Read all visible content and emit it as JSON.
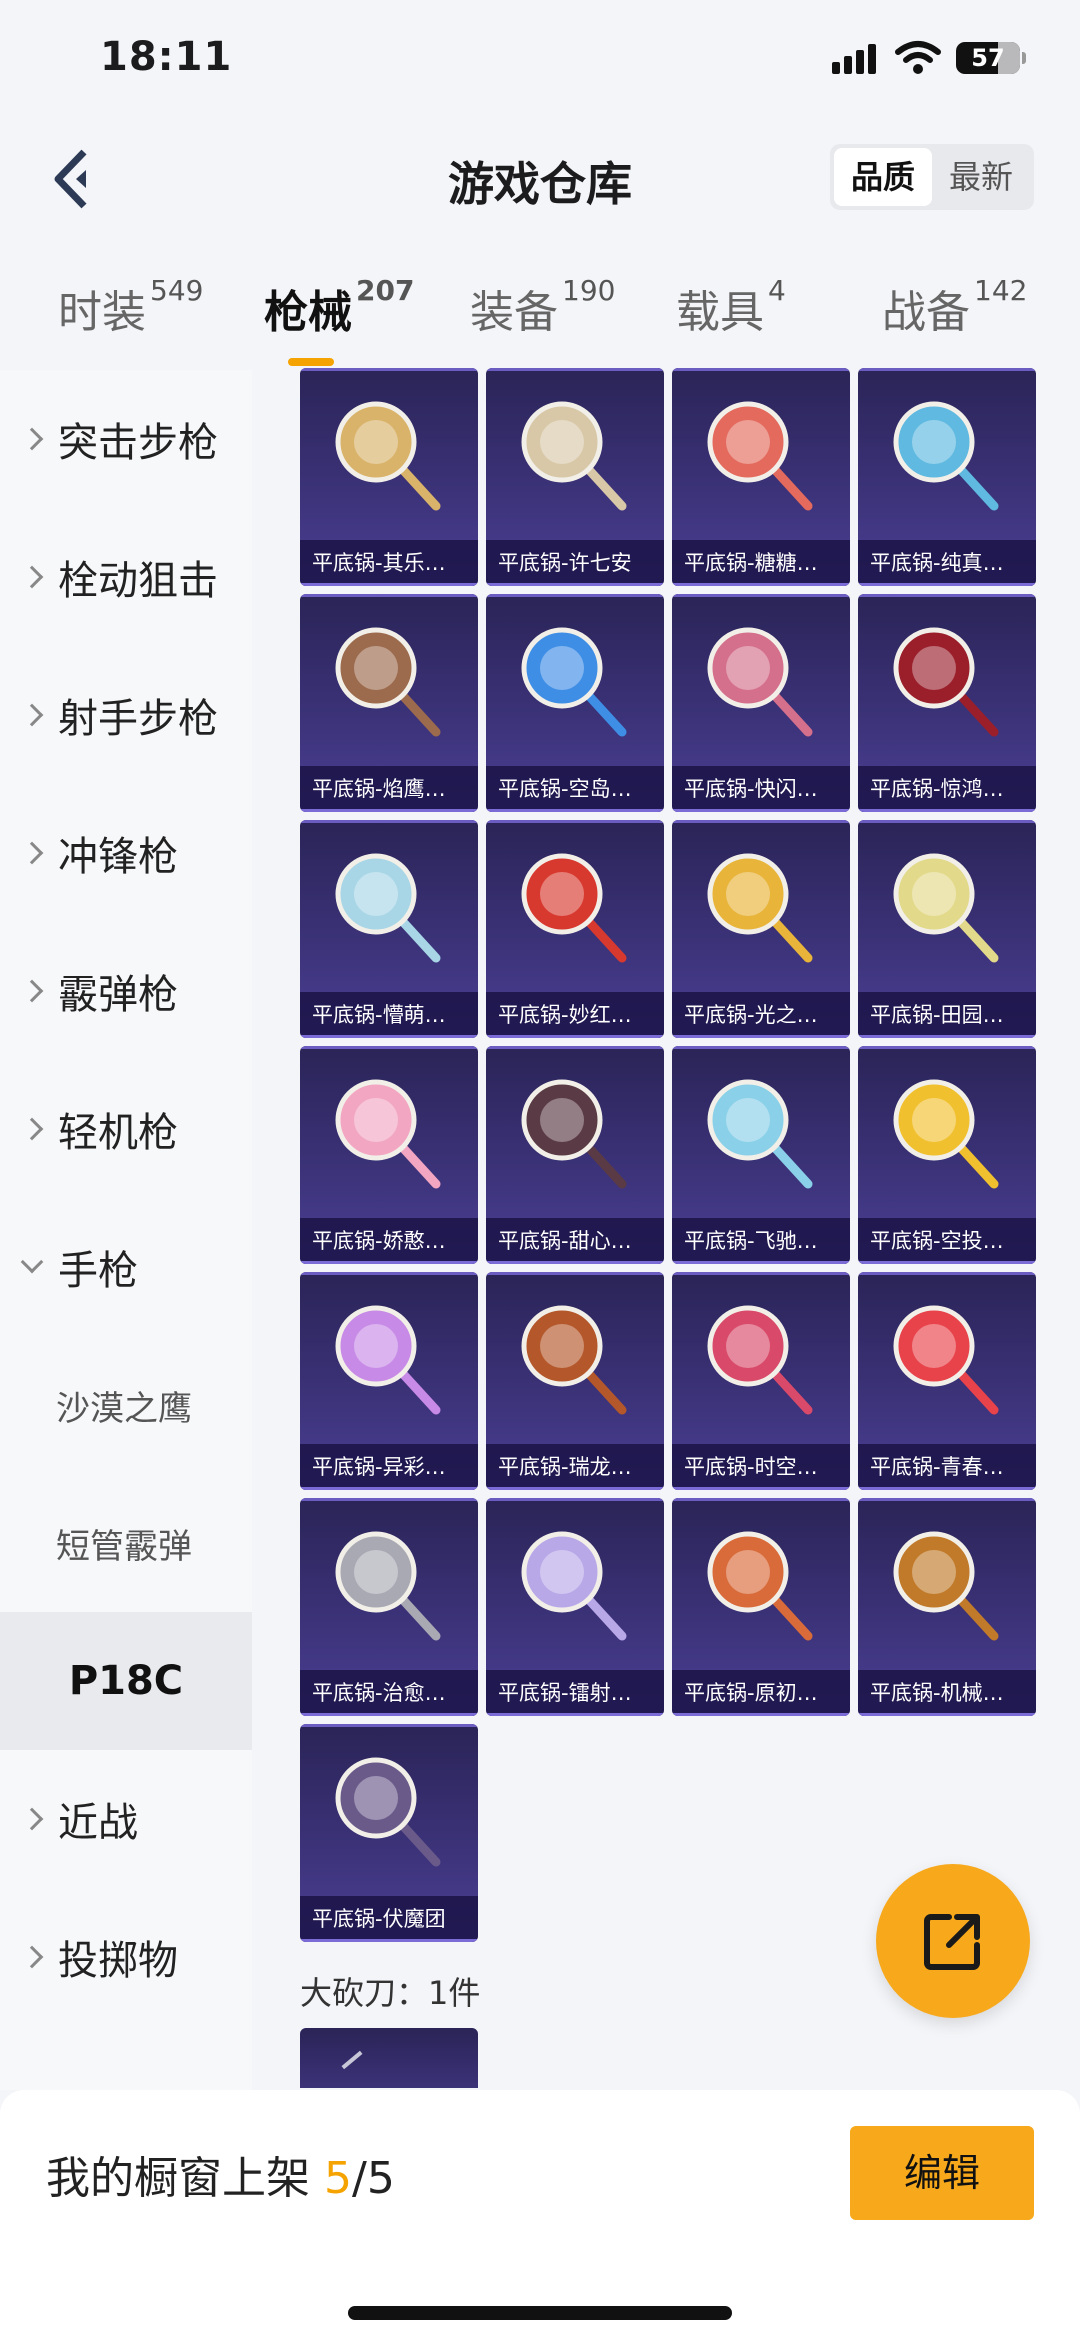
{
  "status_bar": {
    "time": "18:11",
    "battery": "57"
  },
  "header": {
    "title": "游戏仓库",
    "sort_options": [
      "品质",
      "最新"
    ],
    "selected_sort": "品质"
  },
  "tabs": [
    {
      "label": "时装",
      "count": "549"
    },
    {
      "label": "枪械",
      "count": "207",
      "active": true
    },
    {
      "label": "装备",
      "count": "190"
    },
    {
      "label": "载具",
      "count": "4"
    },
    {
      "label": "战备",
      "count": "142"
    }
  ],
  "sidebar": {
    "items": [
      {
        "label": "突击步枪"
      },
      {
        "label": "栓动狙击"
      },
      {
        "label": "射手步枪"
      },
      {
        "label": "冲锋枪"
      },
      {
        "label": "霰弹枪"
      },
      {
        "label": "轻机枪"
      },
      {
        "label": "手枪",
        "expanded": true
      },
      {
        "label": "沙漠之鹰"
      },
      {
        "label": "短管霰弹"
      },
      {
        "label": "P18C",
        "selected": true
      },
      {
        "label": "近战"
      },
      {
        "label": "投掷物"
      }
    ]
  },
  "grid": {
    "items": [
      {
        "name": "平底锅-其乐…",
        "color": "#d9b36a"
      },
      {
        "name": "平底锅-许七安",
        "color": "#d8c8a8"
      },
      {
        "name": "平底锅-糖糖…",
        "color": "#e36a5c"
      },
      {
        "name": "平底锅-纯真…",
        "color": "#5fb9e0"
      },
      {
        "name": "平底锅-焰鹰…",
        "color": "#9c6a4c"
      },
      {
        "name": "平底锅-空岛…",
        "color": "#3f8ee6"
      },
      {
        "name": "平底锅-快闪…",
        "color": "#d46f8c"
      },
      {
        "name": "平底锅-惊鸿…",
        "color": "#9a1f2b"
      },
      {
        "name": "平底锅-懵萌…",
        "color": "#a8d6e6"
      },
      {
        "name": "平底锅-妙红…",
        "color": "#d8392f"
      },
      {
        "name": "平底锅-光之…",
        "color": "#e8b43a"
      },
      {
        "name": "平底锅-田园…",
        "color": "#e3d98a"
      },
      {
        "name": "平底锅-娇憨…",
        "color": "#f2a6c2"
      },
      {
        "name": "平底锅-甜心…",
        "color": "#5a3a44"
      },
      {
        "name": "平底锅-飞驰…",
        "color": "#8ad0e8"
      },
      {
        "name": "平底锅-空投…",
        "color": "#f1c02e"
      },
      {
        "name": "平底锅-异彩…",
        "color": "#c78ae6"
      },
      {
        "name": "平底锅-瑞龙…",
        "color": "#b4572a"
      },
      {
        "name": "平底锅-时空…",
        "color": "#d94a6a"
      },
      {
        "name": "平底锅-青春…",
        "color": "#e8424a"
      },
      {
        "name": "平底锅-治愈…",
        "color": "#a9a9b4"
      },
      {
        "name": "平底锅-镭射…",
        "color": "#b9a8e8"
      },
      {
        "name": "平底锅-原初…",
        "color": "#d96b3a"
      },
      {
        "name": "平底锅-机械…",
        "color": "#c07a2a"
      },
      {
        "name": "平底锅-伏魔团",
        "color": "#6a5a8a"
      }
    ]
  },
  "section_label": "大砍刀：1件",
  "bottom_bar": {
    "label": "我的橱窗上架",
    "current": "5",
    "total": "/5",
    "edit_label": "编辑"
  },
  "accent_color": "#f7a81b"
}
